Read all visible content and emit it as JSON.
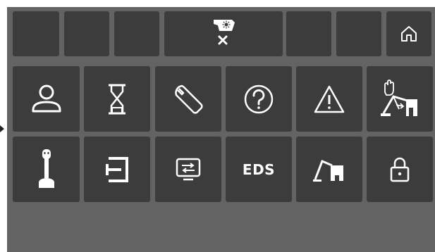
{
  "pointer": {
    "icon": "pointer-arrow-icon"
  },
  "top_bar": {
    "slots": [
      "",
      "",
      "",
      "",
      ""
    ],
    "center_status": {
      "icon": "camera-light-off-icon"
    },
    "home": {
      "icon": "home-icon"
    }
  },
  "menu": {
    "row1": [
      {
        "icon": "user-profile-icon"
      },
      {
        "icon": "hourglass-icon"
      },
      {
        "icon": "wrench-icon"
      },
      {
        "icon": "help-icon"
      },
      {
        "icon": "warning-icon"
      },
      {
        "icon": "stop-machine-hand-icon"
      }
    ],
    "row2": [
      {
        "icon": "joystick-icon"
      },
      {
        "icon": "exit-icon"
      },
      {
        "icon": "display-settings-icon"
      },
      {
        "label": "EDS"
      },
      {
        "icon": "machine-crane-icon"
      },
      {
        "icon": "lock-icon"
      }
    ]
  }
}
